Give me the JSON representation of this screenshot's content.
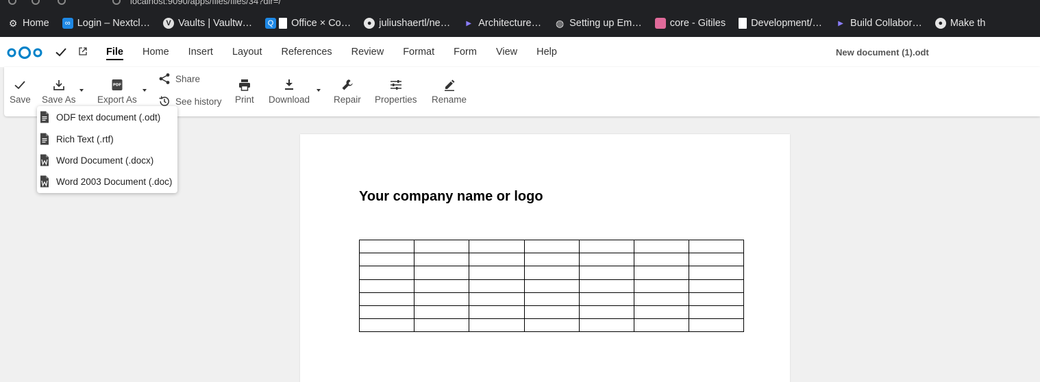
{
  "browser": {
    "url_fragment": "localhost:9090/apps/files/files/34?dir=/",
    "bookmarks": [
      {
        "label": "Home",
        "icon": "gear-icon"
      },
      {
        "label": "Login – Nextcl…",
        "icon": "nextcloud-icon"
      },
      {
        "label": "Vaults | Vaultw…",
        "icon": "vaultwarden-icon"
      },
      {
        "label": "Office × Co…",
        "icon": "collabora-icon"
      },
      {
        "label": "juliushaertl/ne…",
        "icon": "github-icon"
      },
      {
        "label": "Architecture…",
        "icon": "play-icon"
      },
      {
        "label": "Setting up Em…",
        "icon": "globe-icon"
      },
      {
        "label": "core - Gitiles",
        "icon": "gitiles-icon"
      },
      {
        "label": "Development/…",
        "icon": "document-icon"
      },
      {
        "label": "Build Collabor…",
        "icon": "play-icon"
      },
      {
        "label": "Make th",
        "icon": "github-icon"
      }
    ]
  },
  "header": {
    "menu": [
      "File",
      "Home",
      "Insert",
      "Layout",
      "References",
      "Review",
      "Format",
      "Form",
      "View",
      "Help"
    ],
    "active_menu": "File",
    "document_title": "New document (1).odt"
  },
  "toolbar": {
    "save": "Save",
    "save_as": "Save As",
    "export_as": "Export As",
    "share": "Share",
    "see_history": "See history",
    "print": "Print",
    "download": "Download",
    "repair": "Repair",
    "properties": "Properties",
    "rename": "Rename"
  },
  "save_as_menu": [
    {
      "label": "ODF text document (.odt)",
      "icon": "text-document-icon"
    },
    {
      "label": "Rich Text (.rtf)",
      "icon": "text-document-icon"
    },
    {
      "label": "Word Document (.docx)",
      "icon": "word-document-icon"
    },
    {
      "label": "Word 2003 Document (.doc)",
      "icon": "word-document-icon"
    }
  ],
  "document": {
    "heading": "Your company name or logo",
    "table": {
      "rows": 7,
      "cols": 7
    }
  },
  "colors": {
    "accent": "#0082c9",
    "browser_bg": "#202124",
    "workspace_bg": "#f0f0f0"
  }
}
